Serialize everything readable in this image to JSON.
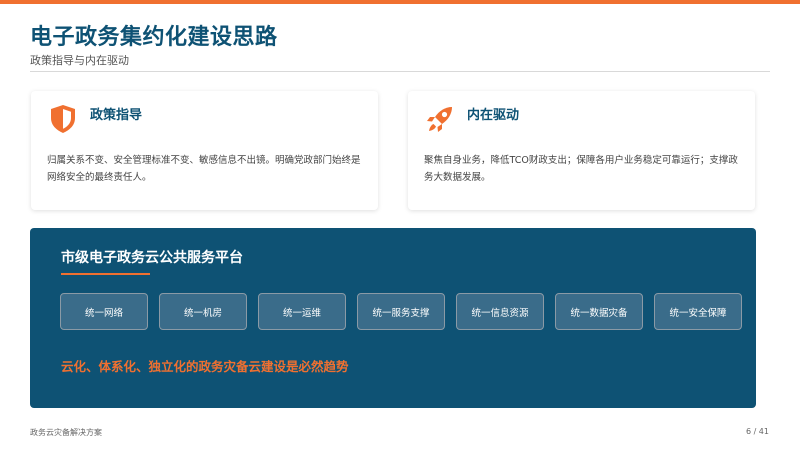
{
  "header": {
    "title": "电子政务集约化建设思路",
    "subtitle": "政策指导与内在驱动"
  },
  "cards": [
    {
      "icon": "shield-icon",
      "title": "政策指导",
      "body": "归属关系不变、安全管理标准不变、敏感信息不出镜。明确党政部门始终是网络安全的最终责任人。"
    },
    {
      "icon": "rocket-icon",
      "title": "内在驱动",
      "body": "聚焦自身业务，降低TCO财政支出；保障各用户业务稳定可靠运行；支撑政务大数据发展。"
    }
  ],
  "platform": {
    "title": "市级电子政务云公共服务平台",
    "items": [
      "统一网络",
      "统一机房",
      "统一运维",
      "统一服务支撑",
      "统一信息资源",
      "统一数据灾备",
      "统一安全保障"
    ],
    "slogan": "云化、体系化、独立化的政务灾备云建设是必然趋势"
  },
  "footer": {
    "left": "政务云灾备解决方案",
    "page": "6 / 41"
  },
  "colors": {
    "accent": "#f07030",
    "primary": "#0e5274"
  }
}
